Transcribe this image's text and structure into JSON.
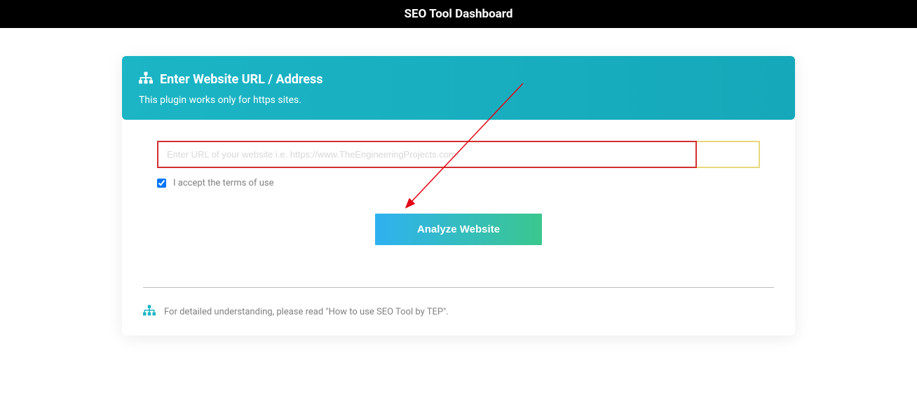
{
  "header": {
    "title": "SEO Tool Dashboard"
  },
  "panel": {
    "title": "Enter Website URL / Address",
    "subtitle": "This plugin works only for https sites."
  },
  "form": {
    "url_placeholder": "Enter URL of your website i.e. https://www.TheEngineeringProjects.com/",
    "url_value": "",
    "terms_label": "I accept the terms of use",
    "terms_checked": true,
    "analyze_label": "Analyze Website"
  },
  "footer": {
    "note": "For detailed understanding, please read \"How to use SEO Tool by TEP\"."
  }
}
